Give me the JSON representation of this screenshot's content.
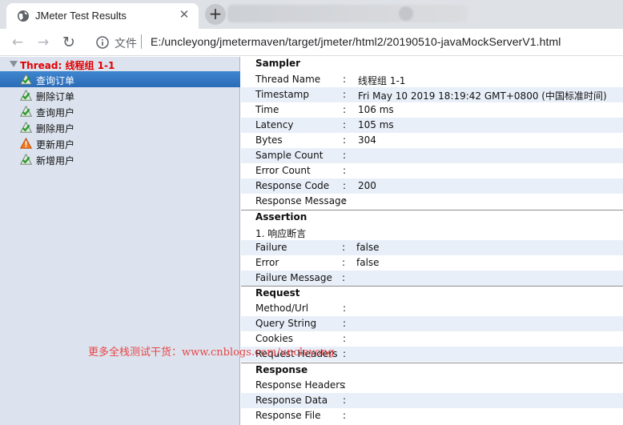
{
  "browser": {
    "tab_title": "JMeter Test Results",
    "tab_close": "✕",
    "new_tab": "+",
    "back": "←",
    "forward": "→",
    "reload": "↻",
    "url_scheme_label": "文件",
    "url": "E:/uncleyong/jmetermaven/target/jmeter/html2/20190510-javaMockServerV1.html"
  },
  "tree": {
    "thread": "Thread: 线程组 1-1",
    "samples": [
      {
        "label": "查询订单",
        "status": "success",
        "selected": true
      },
      {
        "label": "删除订单",
        "status": "success"
      },
      {
        "label": "查询用户",
        "status": "success"
      },
      {
        "label": "删除用户",
        "status": "success"
      },
      {
        "label": "更新用户",
        "status": "failure"
      },
      {
        "label": "新增用户",
        "status": "success"
      }
    ]
  },
  "detail": {
    "colon": ":",
    "sampler": {
      "title": "Sampler",
      "rows": [
        {
          "key": "Thread Name",
          "value": "线程组 1-1"
        },
        {
          "key": "Timestamp",
          "value": "Fri May 10 2019 18:19:42 GMT+0800 (中国标准时间)"
        },
        {
          "key": "Time",
          "value": "106 ms"
        },
        {
          "key": "Latency",
          "value": "105 ms"
        },
        {
          "key": "Bytes",
          "value": "304"
        },
        {
          "key": "Sample Count",
          "value": ""
        },
        {
          "key": "Error Count",
          "value": ""
        },
        {
          "key": "Response Code",
          "value": "200"
        },
        {
          "key": "Response Message",
          "value": ""
        }
      ]
    },
    "assertion": {
      "title": "Assertion",
      "name": "1. 响应断言",
      "rows": [
        {
          "key": "Failure",
          "value": "false"
        },
        {
          "key": "Error",
          "value": "false"
        },
        {
          "key": "Failure Message",
          "value": ""
        }
      ]
    },
    "request": {
      "title": "Request",
      "rows": [
        {
          "key": "Method/Url",
          "value": ""
        },
        {
          "key": "Query String",
          "value": ""
        },
        {
          "key": "Cookies",
          "value": ""
        },
        {
          "key": "Request Headers",
          "value": ""
        }
      ]
    },
    "response": {
      "title": "Response",
      "rows": [
        {
          "key": "Response Headers",
          "value": ""
        },
        {
          "key": "Response Data",
          "value": ""
        },
        {
          "key": "Response File",
          "value": ""
        }
      ]
    }
  },
  "watermark": "更多全栈测试干货：www.cnblogs.com/uncleyong",
  "colors": {
    "selection": "#2f72bd",
    "thread_label": "#e00000",
    "tree_bg": "#dce3ee",
    "alt_row": "#e9eff9"
  }
}
